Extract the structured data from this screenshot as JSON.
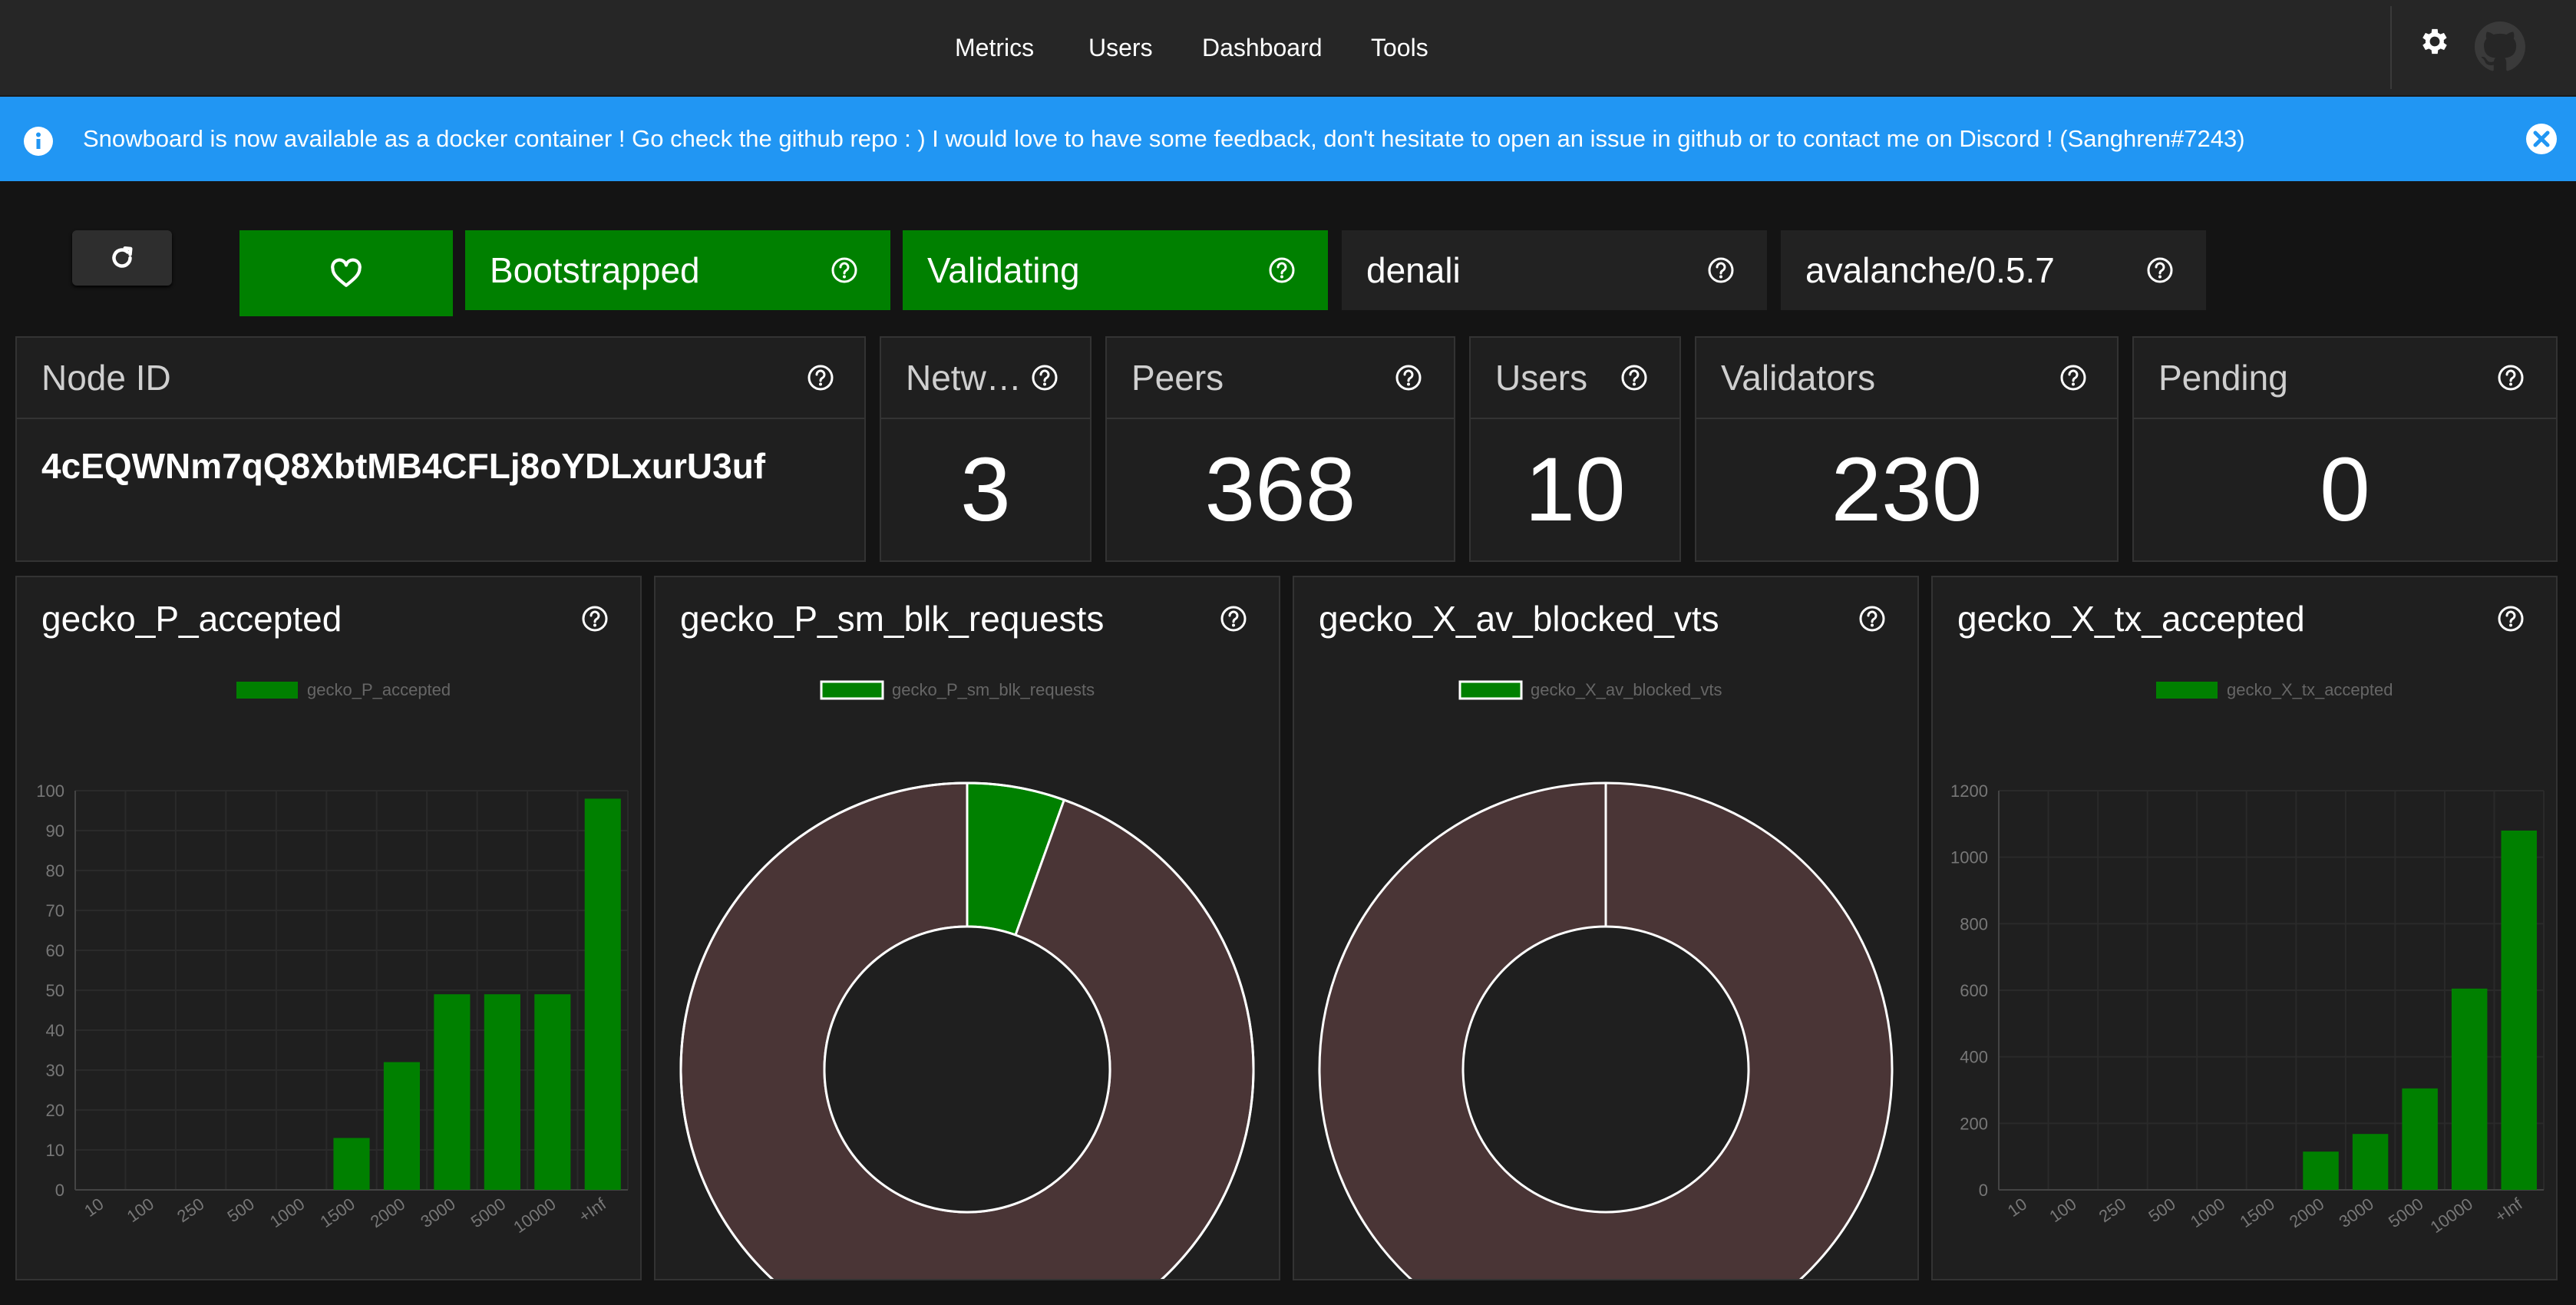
{
  "nav": {
    "items": [
      "Metrics",
      "Users",
      "Dashboard",
      "Tools"
    ]
  },
  "topbar_icons": [
    "gear-icon",
    "github-icon"
  ],
  "banner": {
    "icon": "info-icon",
    "text": "Snowboard is now available as a docker container ! Go check the github repo : ) I would love to have some feedback, don't hesitate to open an issue in github or to contact me on Discord ! (Sanghren#7243)",
    "close_icon": "close-icon",
    "color": "#2196f3"
  },
  "status": {
    "refresh_icon": "refresh-icon",
    "health_icon": "heart-icon",
    "bootstrapped": "Bootstrapped",
    "validating": "Validating",
    "network_name": "denali",
    "version": "avalanche/0.5.7",
    "green": "#008000"
  },
  "stats": {
    "node_id_label": "Node ID",
    "node_id_value": "4cEQWNm7qQ8XbtMB4CFLj8oYDLxurU3uf",
    "network_label": "Netw…",
    "network_value": "3",
    "peers_label": "Peers",
    "peers_value": "368",
    "users_label": "Users",
    "users_value": "10",
    "validators_label": "Validators",
    "validators_value": "230",
    "pending_label": "Pending",
    "pending_value": "0"
  },
  "chart_data": [
    {
      "type": "bar",
      "title": "gecko_P_accepted",
      "series": [
        {
          "name": "gecko_P_accepted",
          "values": [
            0,
            0,
            0,
            0,
            0,
            13,
            32,
            49,
            49,
            49,
            98
          ]
        }
      ],
      "categories": [
        "10",
        "100",
        "250",
        "500",
        "1000",
        "1500",
        "2000",
        "3000",
        "5000",
        "10000",
        "+Inf"
      ],
      "ylim": [
        0,
        100
      ],
      "yticks": [
        0,
        10,
        20,
        30,
        40,
        50,
        60,
        70,
        80,
        90,
        100
      ],
      "color": "#008000"
    },
    {
      "type": "pie",
      "title": "gecko_P_sm_blk_requests",
      "legend": "gecko_P_sm_blk_requests",
      "values": [
        5.5,
        94.5
      ],
      "colors": [
        "#008000",
        "#4a3536"
      ],
      "donut": true
    },
    {
      "type": "pie",
      "title": "gecko_X_av_blocked_vts",
      "legend": "gecko_X_av_blocked_vts",
      "values": [
        0,
        100
      ],
      "colors": [
        "#008000",
        "#4a3536"
      ],
      "donut": true
    },
    {
      "type": "bar",
      "title": "gecko_X_tx_accepted",
      "series": [
        {
          "name": "gecko_X_tx_accepted",
          "values": [
            0,
            0,
            0,
            0,
            0,
            0,
            115,
            168,
            305,
            605,
            1080
          ]
        }
      ],
      "categories": [
        "10",
        "100",
        "250",
        "500",
        "1000",
        "1500",
        "2000",
        "3000",
        "5000",
        "10000",
        "+Inf"
      ],
      "ylim": [
        0,
        1200
      ],
      "yticks": [
        0,
        200,
        400,
        600,
        800,
        1000,
        1200
      ],
      "color": "#008000"
    }
  ]
}
